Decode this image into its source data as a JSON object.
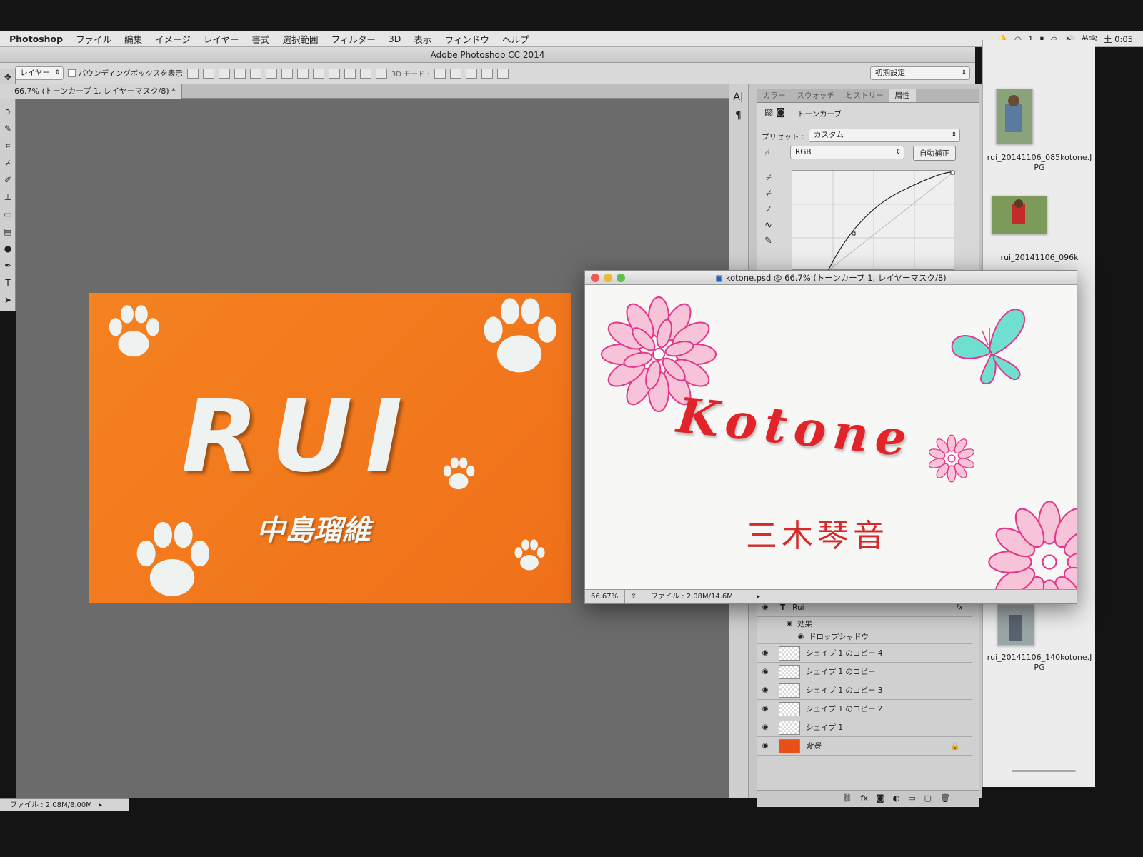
{
  "menubar": {
    "app": "Photoshop",
    "items": [
      "ファイル",
      "編集",
      "イメージ",
      "レイヤー",
      "書式",
      "選択範囲",
      "フィルター",
      "3D",
      "表示",
      "ウィンドウ",
      "ヘルプ"
    ],
    "status": {
      "wifi_count": "1",
      "input": "英字",
      "clock": "土 0:05"
    }
  },
  "app_title": "Adobe Photoshop CC 2014",
  "options": {
    "auto_select": "レイヤー",
    "bounding_box": "バウンディングボックスを表示",
    "mode_3d": "3D モード :",
    "workspace": "初期設定"
  },
  "doc_tab": "66.7% (トーンカーブ 1, レイヤーマスク/8) *",
  "rui_card": {
    "title": "RUI",
    "subtitle": "中島瑠維"
  },
  "main_status": "ファイル : 2.08M/8.00M",
  "panels": {
    "tabs": [
      "カラー",
      "スウォッチ",
      "ヒストリー",
      "属性"
    ],
    "properties_title": "トーンカーブ",
    "preset_label": "プリセット :",
    "preset_value": "カスタム",
    "channel": "RGB",
    "auto_button": "自動補正"
  },
  "layers": {
    "top": {
      "name": "Rui",
      "fx": "fx"
    },
    "effects": "効果",
    "drop_shadow": "ドロップシャドウ",
    "rows": [
      "シェイプ 1 のコピー 4",
      "シェイプ 1 のコピー",
      "シェイプ 1 のコピー 3",
      "シェイプ 1 のコピー 2",
      "シェイプ 1"
    ],
    "background": "背景"
  },
  "kotone_window": {
    "title": "kotone.psd @ 66.7% (トーンカーブ 1, レイヤーマスク/8)",
    "name": "Kotone",
    "subtitle": "三木琴音",
    "zoom": "66.67%",
    "file": "ファイル : 2.08M/14.6M"
  },
  "finder": {
    "files": [
      "rui_20141106_085kotone.JPG",
      "rui_20141106_096k",
      "rui_20141106_140kotone.JPG"
    ]
  },
  "colors": {
    "orange": "#f58220",
    "kotone_red": "#e0242a",
    "flower_pink": "#e2378a",
    "butterfly": "#6fe0cf"
  }
}
